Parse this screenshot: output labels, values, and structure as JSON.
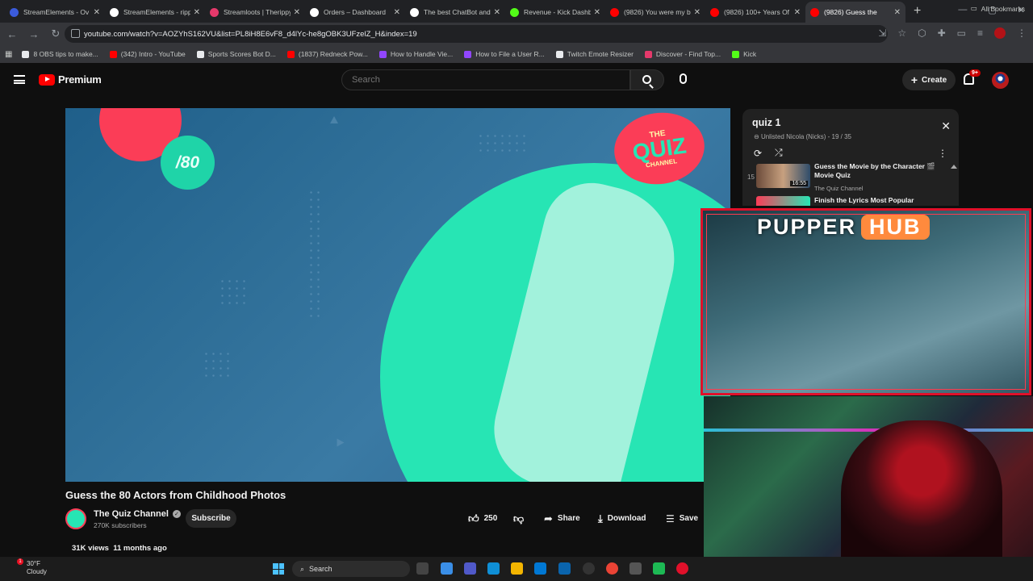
{
  "browser": {
    "tabs": [
      {
        "title": "StreamElements - Ov",
        "color": "#3b5bdb"
      },
      {
        "title": "StreamElements - ripp",
        "color": "#ffffff"
      },
      {
        "title": "Streamloots | Therippy",
        "color": "#e5396b"
      },
      {
        "title": "Orders – Dashboard",
        "color": "#ffffff"
      },
      {
        "title": "The best ChatBot and",
        "color": "#ffffff"
      },
      {
        "title": "Revenue - Kick Dashb",
        "color": "#53fc18"
      },
      {
        "title": "(9826) You were my b",
        "color": "#ff0000"
      },
      {
        "title": "(9826) 100+ Years Of",
        "color": "#ff0000"
      },
      {
        "title": "(9826) Guess the",
        "color": "#ff0000",
        "active": true
      }
    ],
    "url": "youtube.com/watch?v=AOZYhS162VU&list=PL8iH8E6vF8_d4lYc-he8gOBK3UFzelZ_H&index=19",
    "bookmarks": [
      {
        "label": "8 OBS tips to make...",
        "color": "#e8eaed"
      },
      {
        "label": "(342) Intro - YouTube",
        "color": "#ff0000"
      },
      {
        "label": "Sports Scores Bot D...",
        "color": "#e8eaed"
      },
      {
        "label": "(1837) Redneck Pow...",
        "color": "#ff0000"
      },
      {
        "label": "How to Handle Vie...",
        "color": "#9146ff"
      },
      {
        "label": "How to File a User R...",
        "color": "#9146ff"
      },
      {
        "label": "Twitch Emote Resizer",
        "color": "#e8eaed"
      },
      {
        "label": "Discover - Find Top...",
        "color": "#e5396b"
      },
      {
        "label": "Kick",
        "color": "#53fc18"
      }
    ],
    "all_bookmarks": "All Bookmarks"
  },
  "yt": {
    "brand": "Premium",
    "search_placeholder": "Search",
    "create_label": "Create",
    "notif_count": "9+"
  },
  "video": {
    "overlay_badge": "/80",
    "logo_line1": "THE",
    "logo_line2": "QUIZ",
    "logo_line3": "CHANNEL",
    "title": "Guess the 80 Actors from Childhood Photos",
    "channel": "The Quiz Channel",
    "subscribers": "270K subscribers",
    "subscribe_label": "Subscribe",
    "likes": "250",
    "share_label": "Share",
    "download_label": "Download",
    "save_label": "Save",
    "views": "31K views",
    "age": "11 months ago"
  },
  "playlist": {
    "title": "quiz 1",
    "meta": "Unlisted Nicola (Nicks) - 19 / 35",
    "items": [
      {
        "index": "15",
        "title": "Guess the Movie by the Character 🎬 Movie Quiz",
        "channel": "The Quiz Channel",
        "duration": "16:55"
      },
      {
        "index": "",
        "title": "Finish the Lyrics Most Popular",
        "channel": "",
        "duration": ""
      }
    ]
  },
  "stream_overlay": {
    "word1": "PUPPER",
    "word2": "HUB"
  },
  "taskbar": {
    "temp": "30°F",
    "condition": "Cloudy",
    "badge": "1",
    "search_label": "Search"
  }
}
